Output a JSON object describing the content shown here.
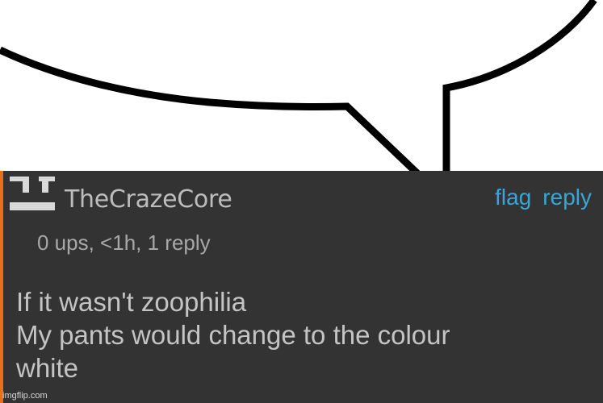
{
  "comment": {
    "username": "TheCrazeCore",
    "actions": {
      "flag_label": "flag",
      "reply_label": "reply"
    },
    "meta": "0 ups, <1h, 1 reply",
    "body_lines": [
      "If it wasn't zoophilia",
      "My pants would change to the colour",
      "white"
    ]
  },
  "colors": {
    "panel_bg": "#333333",
    "accent": "#e8701a",
    "link": "#38a6d9",
    "text": "#c4c4c4"
  },
  "watermark": "imgflip.com"
}
